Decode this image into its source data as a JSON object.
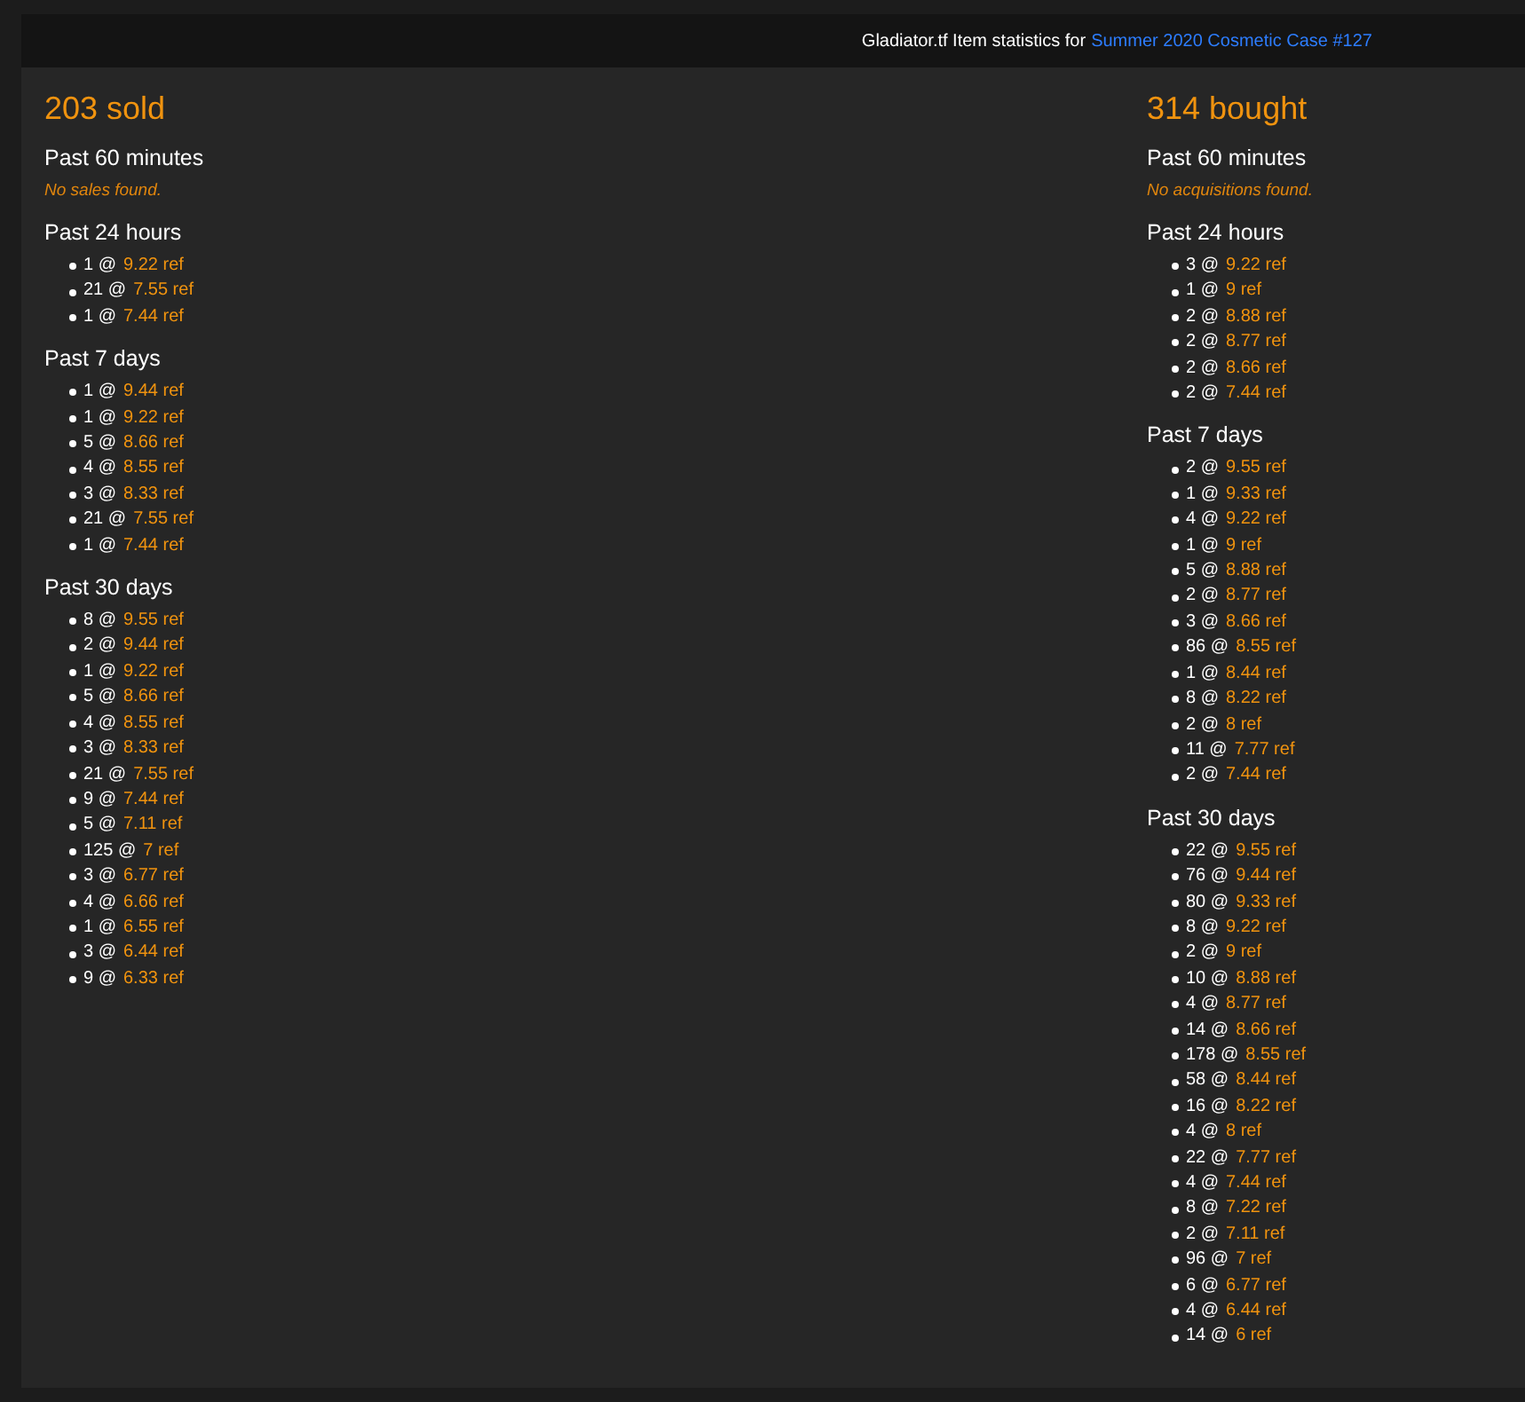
{
  "header": {
    "text": "Gladiator.tf Item statistics for",
    "link": "Summer 2020 Cosmetic Case #127"
  },
  "columns": [
    {
      "title": "203 sold",
      "sections": [
        {
          "heading": "Past 60 minutes",
          "empty": "No sales found."
        },
        {
          "heading": "Past 24 hours",
          "items": [
            {
              "amount": "1 @",
              "price": "9.22 ref"
            },
            {
              "amount": "21 @",
              "price": "7.55 ref"
            },
            {
              "amount": "1 @",
              "price": "7.44 ref"
            }
          ]
        },
        {
          "heading": "Past 7 days",
          "items": [
            {
              "amount": "1 @",
              "price": "9.44 ref"
            },
            {
              "amount": "1 @",
              "price": "9.22 ref"
            },
            {
              "amount": "5 @",
              "price": "8.66 ref"
            },
            {
              "amount": "4 @",
              "price": "8.55 ref"
            },
            {
              "amount": "3 @",
              "price": "8.33 ref"
            },
            {
              "amount": "21 @",
              "price": "7.55 ref"
            },
            {
              "amount": "1 @",
              "price": "7.44 ref"
            }
          ]
        },
        {
          "heading": "Past 30 days",
          "items": [
            {
              "amount": "8 @",
              "price": "9.55 ref"
            },
            {
              "amount": "2 @",
              "price": "9.44 ref"
            },
            {
              "amount": "1 @",
              "price": "9.22 ref"
            },
            {
              "amount": "5 @",
              "price": "8.66 ref"
            },
            {
              "amount": "4 @",
              "price": "8.55 ref"
            },
            {
              "amount": "3 @",
              "price": "8.33 ref"
            },
            {
              "amount": "21 @",
              "price": "7.55 ref"
            },
            {
              "amount": "9 @",
              "price": "7.44 ref"
            },
            {
              "amount": "5 @",
              "price": "7.11 ref"
            },
            {
              "amount": "125 @",
              "price": "7 ref"
            },
            {
              "amount": "3 @",
              "price": "6.77 ref"
            },
            {
              "amount": "4 @",
              "price": "6.66 ref"
            },
            {
              "amount": "1 @",
              "price": "6.55 ref"
            },
            {
              "amount": "3 @",
              "price": "6.44 ref"
            },
            {
              "amount": "9 @",
              "price": "6.33 ref"
            }
          ]
        }
      ]
    },
    {
      "title": "314 bought",
      "sections": [
        {
          "heading": "Past 60 minutes",
          "empty": "No acquisitions found."
        },
        {
          "heading": "Past 24 hours",
          "items": [
            {
              "amount": "3 @",
              "price": "9.22 ref"
            },
            {
              "amount": "1 @",
              "price": "9 ref"
            },
            {
              "amount": "2 @",
              "price": "8.88 ref"
            },
            {
              "amount": "2 @",
              "price": "8.77 ref"
            },
            {
              "amount": "2 @",
              "price": "8.66 ref"
            },
            {
              "amount": "2 @",
              "price": "7.44 ref"
            }
          ]
        },
        {
          "heading": "Past 7 days",
          "items": [
            {
              "amount": "2 @",
              "price": "9.55 ref"
            },
            {
              "amount": "1 @",
              "price": "9.33 ref"
            },
            {
              "amount": "4 @",
              "price": "9.22 ref"
            },
            {
              "amount": "1 @",
              "price": "9 ref"
            },
            {
              "amount": "5 @",
              "price": "8.88 ref"
            },
            {
              "amount": "2 @",
              "price": "8.77 ref"
            },
            {
              "amount": "3 @",
              "price": "8.66 ref"
            },
            {
              "amount": "86 @",
              "price": "8.55 ref"
            },
            {
              "amount": "1 @",
              "price": "8.44 ref"
            },
            {
              "amount": "8 @",
              "price": "8.22 ref"
            },
            {
              "amount": "2 @",
              "price": "8 ref"
            },
            {
              "amount": "11 @",
              "price": "7.77 ref"
            },
            {
              "amount": "2 @",
              "price": "7.44 ref"
            }
          ]
        },
        {
          "heading": "Past 30 days",
          "items": [
            {
              "amount": "22 @",
              "price": "9.55 ref"
            },
            {
              "amount": "76 @",
              "price": "9.44 ref"
            },
            {
              "amount": "80 @",
              "price": "9.33 ref"
            },
            {
              "amount": "8 @",
              "price": "9.22 ref"
            },
            {
              "amount": "2 @",
              "price": "9 ref"
            },
            {
              "amount": "10 @",
              "price": "8.88 ref"
            },
            {
              "amount": "4 @",
              "price": "8.77 ref"
            },
            {
              "amount": "14 @",
              "price": "8.66 ref"
            },
            {
              "amount": "178 @",
              "price": "8.55 ref"
            },
            {
              "amount": "58 @",
              "price": "8.44 ref"
            },
            {
              "amount": "16 @",
              "price": "8.22 ref"
            },
            {
              "amount": "4 @",
              "price": "8 ref"
            },
            {
              "amount": "22 @",
              "price": "7.77 ref"
            },
            {
              "amount": "4 @",
              "price": "7.44 ref"
            },
            {
              "amount": "8 @",
              "price": "7.22 ref"
            },
            {
              "amount": "2 @",
              "price": "7.11 ref"
            },
            {
              "amount": "96 @",
              "price": "7 ref"
            },
            {
              "amount": "6 @",
              "price": "6.77 ref"
            },
            {
              "amount": "4 @",
              "price": "6.44 ref"
            },
            {
              "amount": "14 @",
              "price": "6 ref"
            }
          ]
        }
      ]
    }
  ]
}
